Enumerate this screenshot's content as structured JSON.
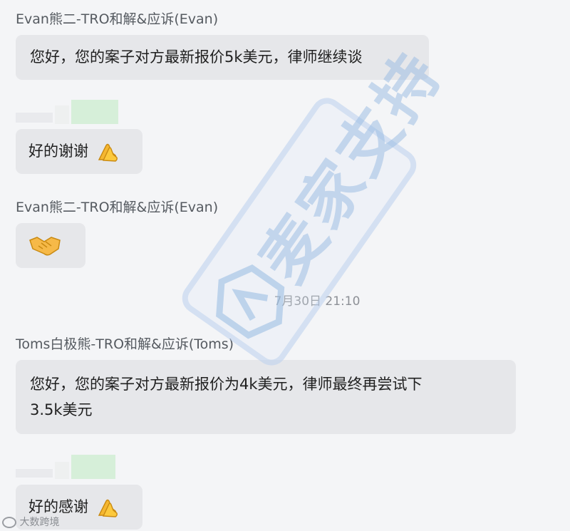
{
  "messages": [
    {
      "sender": "Evan熊二-TRO和解&应诉(Evan)",
      "text": "您好，您的案子对方最新报价5k美元，律师继续谈"
    },
    {
      "text": "好的谢谢",
      "emoji": "clapping-hands-icon"
    },
    {
      "sender": "Evan熊二-TRO和解&应诉(Evan)",
      "emoji": "handshake-icon"
    },
    {
      "timestamp": "7月30日 21:10"
    },
    {
      "sender": "Toms白极熊-TRO和解&应诉(Toms)",
      "text_line1": "您好，您的案子对方最新报价为4k美元，律师最终再尝试下",
      "text_line2": "3.5k美元"
    },
    {
      "text": "好的感谢",
      "emoji": "clapping-hands-icon"
    }
  ],
  "watermark": {
    "text": "麦家支持"
  },
  "footer": {
    "logo_text": "大数跨境"
  },
  "colors": {
    "background": "#f4f5f7",
    "bubble": "#e6e7ea",
    "sender": "#555a60",
    "watermark": "#b4cdeb"
  }
}
